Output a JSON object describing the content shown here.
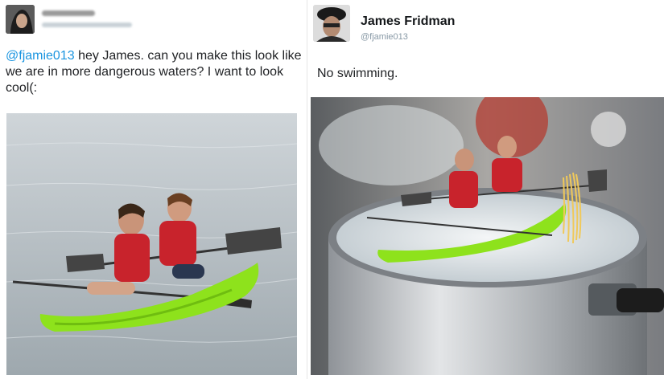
{
  "left_tweet": {
    "mention": "@fjamie013",
    "text": " hey James. can you make this look like we are in more dangerous waters? I want to look cool(:"
  },
  "right_tweet": {
    "author_name": "James Fridman",
    "author_handle": "@fjamie013",
    "text": "No swimming."
  },
  "colors": {
    "mention": "#1b95e0",
    "kayak": "#8ee21c",
    "vest": "#c8232c",
    "water": "#b9c2c8",
    "pot": "#b8bcc0"
  }
}
